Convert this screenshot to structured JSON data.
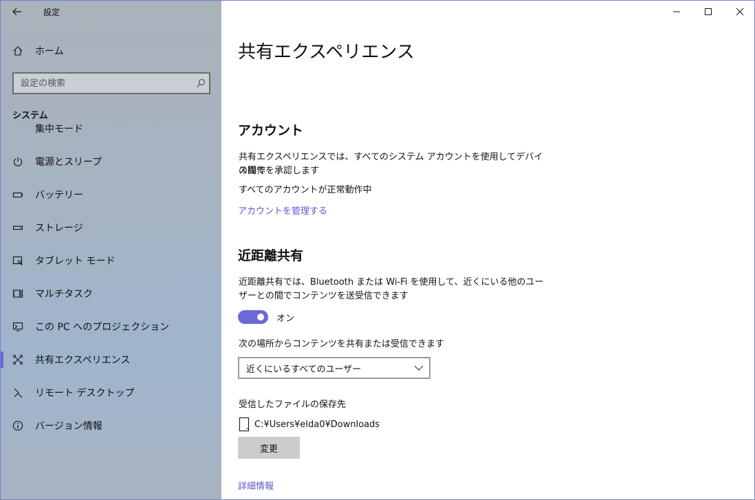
{
  "app": {
    "title": "設定"
  },
  "sidebar": {
    "home_label": "ホーム",
    "search_placeholder": "設定の検索",
    "section_title": "システム",
    "partial_item_label": "集中モード",
    "items": [
      {
        "label": "電源とスリープ",
        "icon": "power-icon"
      },
      {
        "label": "バッテリー",
        "icon": "battery-icon"
      },
      {
        "label": "ストレージ",
        "icon": "storage-icon"
      },
      {
        "label": "タブレット モード",
        "icon": "tablet-mode-icon"
      },
      {
        "label": "マルチタスク",
        "icon": "multitasking-icon"
      },
      {
        "label": "この PC へのプロジェクション",
        "icon": "projection-icon"
      },
      {
        "label": "共有エクスペリエンス",
        "icon": "shared-experiences-icon",
        "selected": true
      },
      {
        "label": "リモート デスクトップ",
        "icon": "remote-desktop-icon"
      },
      {
        "label": "バージョン情報",
        "icon": "info-icon"
      }
    ]
  },
  "main": {
    "title": "共有エクスペリエンス",
    "account": {
      "heading": "アカウント",
      "desc_line1": "共有エクスペリエンスでは、すべてのシステム アカウントを使用してデバイス間で",
      "desc_line2": "の操作を承認します",
      "status": "すべてのアカウントが正常動作中",
      "manage_link": "アカウントを管理する"
    },
    "nearby": {
      "heading": "近距離共有",
      "desc_line1": "近距離共有では、Bluetooth または Wi-Fi を使用して、近くにいる他のユー",
      "desc_line2": "ザーとの間でコンテンツを送受信できます",
      "toggle_state": "オン",
      "toggle_on": true,
      "share_label": "次の場所からコンテンツを共有または受信できます",
      "share_value": "近くにいるすべてのユーザー",
      "save_label": "受信したファイルの保存先",
      "save_path": "C:¥Users¥elda0¥Downloads",
      "change_button": "変更"
    },
    "more_info_link": "詳細情報"
  },
  "colors": {
    "accent": "#6b69d6",
    "link": "#5b58c9"
  }
}
